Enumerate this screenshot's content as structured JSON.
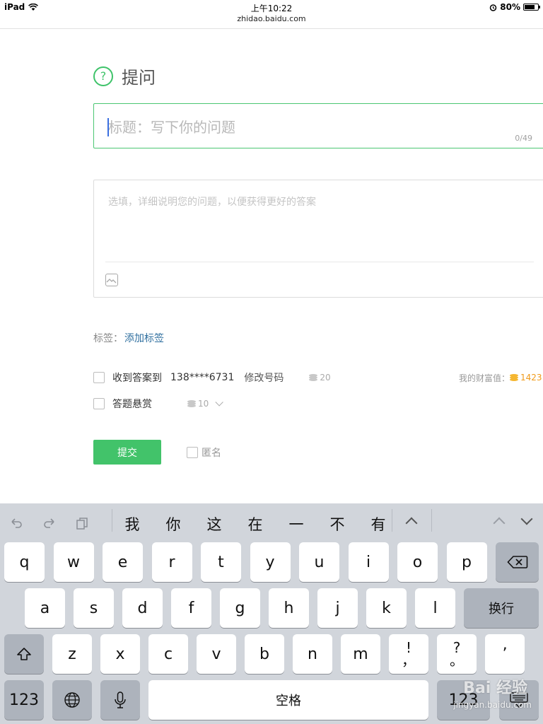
{
  "status_bar": {
    "device": "iPad",
    "time": "上午10:22",
    "url": "zhidao.baidu.com",
    "battery": "80%",
    "battery_level": 0.8
  },
  "form": {
    "page_title": "提问",
    "title_placeholder": "标题：写下你的问题",
    "title_counter": "0/49",
    "desc_placeholder": "选填，详细说明您的问题，以便获得更好的答案",
    "tags_label": "标签：",
    "add_tag": "添加标签",
    "receive_label": "收到答案到",
    "phone": "138****6731",
    "edit_phone": "修改号码",
    "receive_cost": "20",
    "wealth_label": "我的财富值：",
    "wealth_value": "1423",
    "reward_label": "答题悬赏",
    "reward_value": "10",
    "submit": "提交",
    "anonymous": "匿名"
  },
  "keyboard": {
    "candidates": [
      "我",
      "你",
      "这",
      "在",
      "一",
      "不",
      "有"
    ],
    "row1": [
      "q",
      "w",
      "e",
      "r",
      "t",
      "y",
      "u",
      "i",
      "o",
      "p"
    ],
    "row2": [
      "a",
      "s",
      "d",
      "f",
      "g",
      "h",
      "j",
      "k",
      "l"
    ],
    "row3": [
      "z",
      "x",
      "c",
      "v",
      "b",
      "n",
      "m"
    ],
    "punct1_top": "!",
    "punct1_bottom": "，",
    "punct2_top": "?",
    "punct2_bottom": "。",
    "apostrophe": "’",
    "return_label": "换行",
    "space_label": "空格",
    "num_label": "123",
    "num_label_right": "123"
  },
  "watermark": {
    "brand": "Bai 经验",
    "url": "jingyan.baidu.com"
  }
}
